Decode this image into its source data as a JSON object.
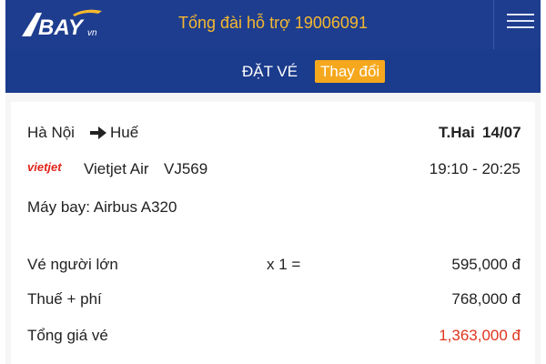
{
  "header": {
    "logo_text": "BAY",
    "logo_suffix": "vn",
    "hotline": "Tổng đài hỗ trợ 19006091",
    "menu_icon": "hamburger-menu-icon"
  },
  "subheader": {
    "title": "ĐẶT VÉ",
    "change_label": "Thay đổi"
  },
  "flight": {
    "origin": "Hà Nội",
    "arrow_icon": "arrow-right-icon",
    "destination": "Huế",
    "day": "T.Hai",
    "date": "14/07",
    "airline_logo_text": "vietjet",
    "airline": "Vietjet Air",
    "flight_number": "VJ569",
    "time": "19:10 - 20:25",
    "aircraft": "Máy bay: Airbus A320"
  },
  "pricing": {
    "adult_label": "Vé người lớn",
    "adult_qty": "x 1 =",
    "adult_price": "595,000 đ",
    "tax_label": "Thuế + phí",
    "tax_price": "768,000 đ",
    "total_label": "Tổng giá vé",
    "total_price": "1,363,000 đ"
  },
  "colors": {
    "header_bg": "#1e3d8f",
    "accent_orange": "#f5a81d",
    "hotline_text": "#f5b82e",
    "total_red": "#e0341e"
  }
}
